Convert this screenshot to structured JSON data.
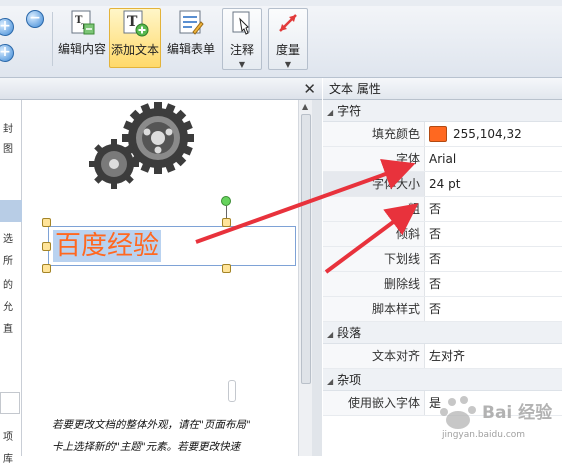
{
  "toolbar": {
    "zoom_in_symbol": "+",
    "zoom_out_symbol": "−",
    "buttons": [
      {
        "label": "编辑内容",
        "icon": "edit-content-icon"
      },
      {
        "label": "添加文本",
        "icon": "add-text-icon",
        "active": true
      },
      {
        "label": "编辑表单",
        "icon": "edit-form-icon"
      },
      {
        "label": "注释",
        "icon": "annotation-icon",
        "dropdown": true
      },
      {
        "label": "度量",
        "icon": "measure-icon",
        "dropdown": true
      }
    ],
    "caret": "▼"
  },
  "document": {
    "close_symbol": "✕",
    "left_column_chars": [
      "封",
      "图",
      "选",
      "所",
      "的",
      "允",
      "直",
      "项",
      "库"
    ],
    "selected_text": "百度经验",
    "selected_text_color": "#ff6820",
    "paragraph_lines": [
      "若要更改文档的整体外观，请在\"页面布局\"",
      "卡上选择新的\"主题\"元素。若要更改快速"
    ]
  },
  "properties": {
    "title": "文本 属性",
    "sections": [
      {
        "name": "字符",
        "rows": [
          {
            "key": "填充颜色",
            "value": "255,104,32",
            "swatch": "#ff6820"
          },
          {
            "key": "字体",
            "value": "Arial"
          },
          {
            "key": "字体大小",
            "value": "24 pt"
          },
          {
            "key": "粗",
            "value": "否"
          },
          {
            "key": "倾斜",
            "value": "否"
          },
          {
            "key": "下划线",
            "value": "否"
          },
          {
            "key": "删除线",
            "value": "否"
          },
          {
            "key": "脚本样式",
            "value": "否"
          }
        ]
      },
      {
        "name": "段落",
        "rows": [
          {
            "key": "文本对齐",
            "value": "左对齐"
          }
        ]
      },
      {
        "name": "杂项",
        "rows": [
          {
            "key": "使用嵌入字体",
            "value": "是"
          }
        ]
      }
    ]
  },
  "colors": {
    "annotation_arrow": "#e8323c",
    "accent_active": "#ffd96a"
  },
  "watermark": {
    "text": "Bai 经验",
    "url": "jingyan.baidu.com"
  }
}
